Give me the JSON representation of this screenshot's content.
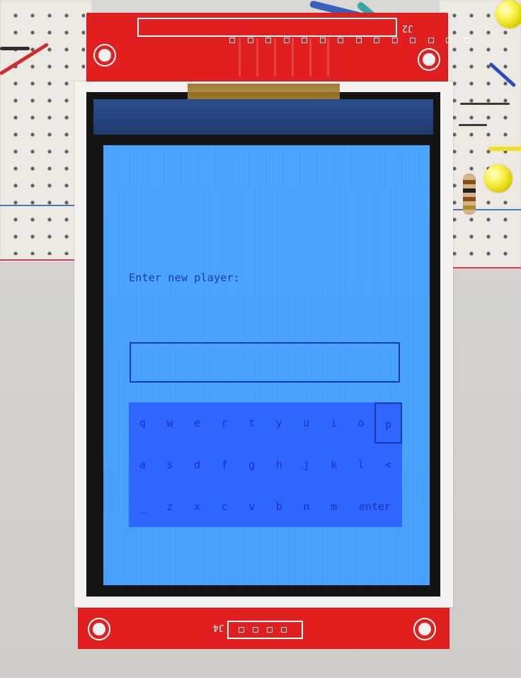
{
  "board": {
    "top_header_label": "J2",
    "bottom_header_label": "J4"
  },
  "screen": {
    "prompt": "Enter new player:",
    "player_name_value": "",
    "keyboard": {
      "row1": [
        "q",
        "w",
        "e",
        "r",
        "t",
        "y",
        "u",
        "i",
        "o",
        "p"
      ],
      "row2": [
        "a",
        "s",
        "d",
        "f",
        "g",
        "h",
        "j",
        "k",
        "l",
        "<"
      ],
      "row3": [
        "_",
        "z",
        "x",
        "c",
        "v",
        "b",
        "n",
        "m",
        "enter"
      ],
      "selected_key": "p"
    }
  },
  "colors": {
    "lcd_background": "#49a6ff",
    "lcd_text": "#1f32b8",
    "keyboard_panel": "#2d67ff",
    "pcb_red": "#e21f1f",
    "led_yellow": "#fff55c"
  },
  "icons": {
    "mount_hole": "mount-hole-icon",
    "header_pin": "header-pin-icon",
    "led": "led-icon",
    "resistor": "resistor-icon"
  }
}
